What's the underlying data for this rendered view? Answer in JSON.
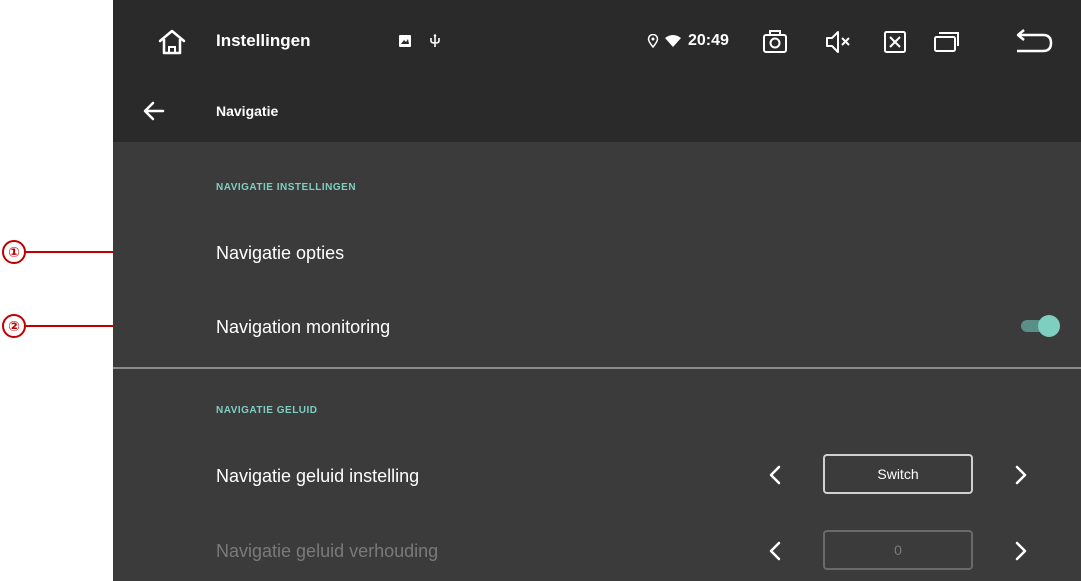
{
  "statusbar": {
    "title": "Instellingen",
    "time": "20:49",
    "icons": [
      "home-icon",
      "image-icon",
      "usb-icon",
      "location-icon",
      "wifi-icon",
      "screenshot-icon",
      "mute-icon",
      "close-box-icon",
      "recent-apps-icon",
      "return-icon"
    ]
  },
  "header": {
    "title": "Navigatie",
    "back_icon": "back-arrow-icon"
  },
  "callouts": [
    "①",
    "②"
  ],
  "sections": [
    {
      "header": "NAVIGATIE INSTELLINGEN",
      "items": [
        {
          "label": "Navigatie opties"
        },
        {
          "label": "Navigation monitoring",
          "toggle": true
        }
      ]
    },
    {
      "header": "NAVIGATIE GELUID",
      "items": [
        {
          "label": "Navigatie geluid instelling",
          "value": "Switch",
          "enabled": true
        },
        {
          "label": "Navigatie geluid verhouding",
          "value": "0",
          "enabled": false
        }
      ]
    }
  ],
  "colors": {
    "accent": "#7ecfc0",
    "callout": "#c00000",
    "background": "#3b3b3b",
    "bar": "#2a2a2a"
  }
}
